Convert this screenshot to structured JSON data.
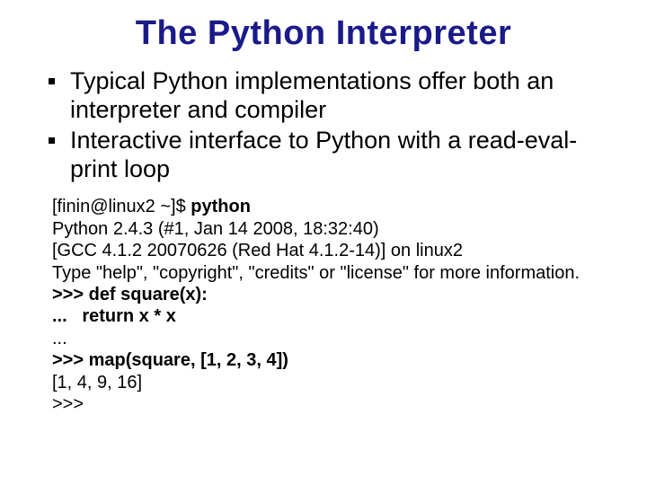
{
  "title": "The Python Interpreter",
  "bullets": [
    "Typical Python implementations offer both an interpreter and compiler",
    "Interactive interface to Python with a read-eval-print loop"
  ],
  "code": {
    "prompt_prefix": "[finin@linux2 ~]$ ",
    "prompt_cmd": "python",
    "l2": "Python 2.4.3 (#1, Jan 14 2008, 18:32:40)",
    "l3": "[GCC 4.1.2 20070626 (Red Hat 4.1.2-14)] on linux2",
    "l4": "Type \"help\", \"copyright\", \"credits\" or \"license\" for more information.",
    "l5": ">>> def square(x):",
    "l6": "...   return x * x",
    "l7": "...",
    "l8": ">>> map(square, [1, 2, 3, 4])",
    "l9": "[1, 4, 9, 16]",
    "l10": ">>>"
  }
}
